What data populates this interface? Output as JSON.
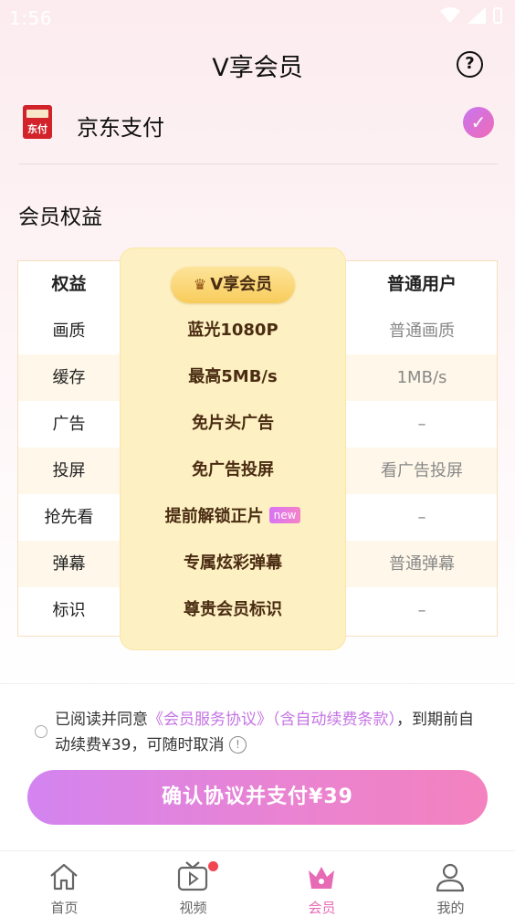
{
  "status_bar": {
    "time": "1:56"
  },
  "header": {
    "title": "V享会员",
    "help_label": "?"
  },
  "payment": {
    "method_name": "京东支付",
    "logo_text": "东付"
  },
  "benefits": {
    "section_title": "会员权益",
    "header": {
      "col1": "权益",
      "vip": "V享会员",
      "normal": "普通用户"
    },
    "rows": [
      {
        "name": "画质",
        "vip": "蓝光1080P",
        "normal": "普通画质",
        "new": ""
      },
      {
        "name": "缓存",
        "vip": "最高5MB/s",
        "normal": "1MB/s",
        "new": ""
      },
      {
        "name": "广告",
        "vip": "免片头广告",
        "normal": "–",
        "new": ""
      },
      {
        "name": "投屏",
        "vip": "免广告投屏",
        "normal": "看广告投屏",
        "new": ""
      },
      {
        "name": "抢先看",
        "vip": "提前解锁正片",
        "normal": "–",
        "new": "new"
      },
      {
        "name": "弹幕",
        "vip": "专属炫彩弹幕",
        "normal": "普通弹幕",
        "new": ""
      },
      {
        "name": "标识",
        "vip": "尊贵会员标识",
        "normal": "–",
        "new": ""
      }
    ]
  },
  "agreement": {
    "prefix": "已阅读并同意",
    "link": "《会员服务协议》（含自动续费条款）",
    "suffix": "，到期前自动续费¥39，可随时取消",
    "info_label": "!"
  },
  "pay_button": {
    "label": "确认协议并支付¥39"
  },
  "tabbar": {
    "items": [
      {
        "label": "首页",
        "icon": "home-icon"
      },
      {
        "label": "视频",
        "icon": "tv-icon"
      },
      {
        "label": "会员",
        "icon": "crown-icon"
      },
      {
        "label": "我的",
        "icon": "profile-icon"
      }
    ],
    "active_index": 2
  },
  "colors": {
    "accent": "#e76ab4",
    "vip_bg": "#fdf0c2",
    "gold": "#f8cc5b"
  }
}
